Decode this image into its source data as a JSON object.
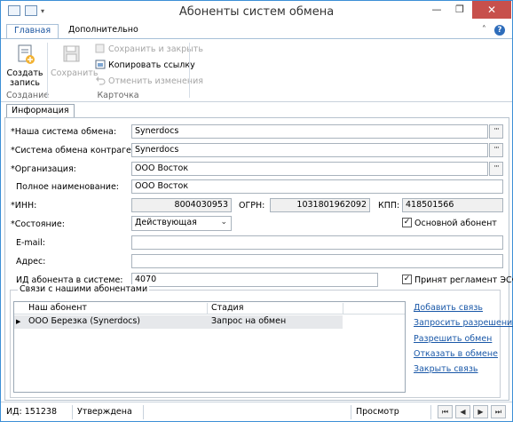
{
  "window": {
    "title": "Абоненты систем обмена",
    "minimize": "—",
    "restore": "❐",
    "close": "✕"
  },
  "ribbon": {
    "tabs": [
      "Главная",
      "Дополнительно"
    ],
    "help": "?",
    "collapse": "˄",
    "create_label_1": "Создать",
    "create_label_2": "запись",
    "save_label": "Сохранить",
    "save_close_label": "Сохранить и закрыть",
    "copy_link_label": "Копировать ссылку",
    "undo_label": "Отменить изменения",
    "group_create": "Создание",
    "group_card": "Карточка"
  },
  "tabs": {
    "info": "Информация"
  },
  "form": {
    "our_system_label": "*Наша система обмена:",
    "our_system_value": "Synerdocs",
    "contr_system_label": "*Система обмена контрагента:",
    "contr_system_value": "Synerdocs",
    "org_label": "*Организация:",
    "org_value": "ООО Восток",
    "fullname_label": "Полное наименование:",
    "fullname_value": "ООО Восток",
    "inn_label": "*ИНН:",
    "inn_value": "8004030953",
    "ogrn_label": "ОГРН:",
    "ogrn_value": "1031801962092",
    "kpp_label": "КПП:",
    "kpp_value": "418501566",
    "state_label": "*Состояние:",
    "state_value": "Действующая",
    "main_subscriber_label": "Основной абонент",
    "main_subscriber_checked": true,
    "email_label": "E-mail:",
    "email_value": "",
    "address_label": "Адрес:",
    "address_value": "",
    "id_label": "ИД абонента в системе:",
    "id_value": "4070",
    "esf_label": "Принят регламент ЭСФ",
    "esf_checked": true,
    "check_mark": "✓",
    "dots": "···",
    "dropdown_arrow": "⌄"
  },
  "relations": {
    "title": "Связи с нашими абонентами",
    "columns": [
      "Наш абонент",
      "Стадия"
    ],
    "rows": [
      {
        "subscriber": "ООО Березка (Synerdocs)",
        "stage": "Запрос на обмен"
      }
    ],
    "row_marker": "▶",
    "actions": [
      "Добавить связь",
      "Запросить разрешение",
      "Разрешить обмен",
      "Отказать в обмене",
      "Закрыть связь"
    ]
  },
  "status": {
    "id": "ИД: 151238",
    "state": "Утверждена",
    "mode": "Просмотр",
    "nav": [
      "⏮",
      "◀",
      "▶",
      "⏭"
    ]
  }
}
